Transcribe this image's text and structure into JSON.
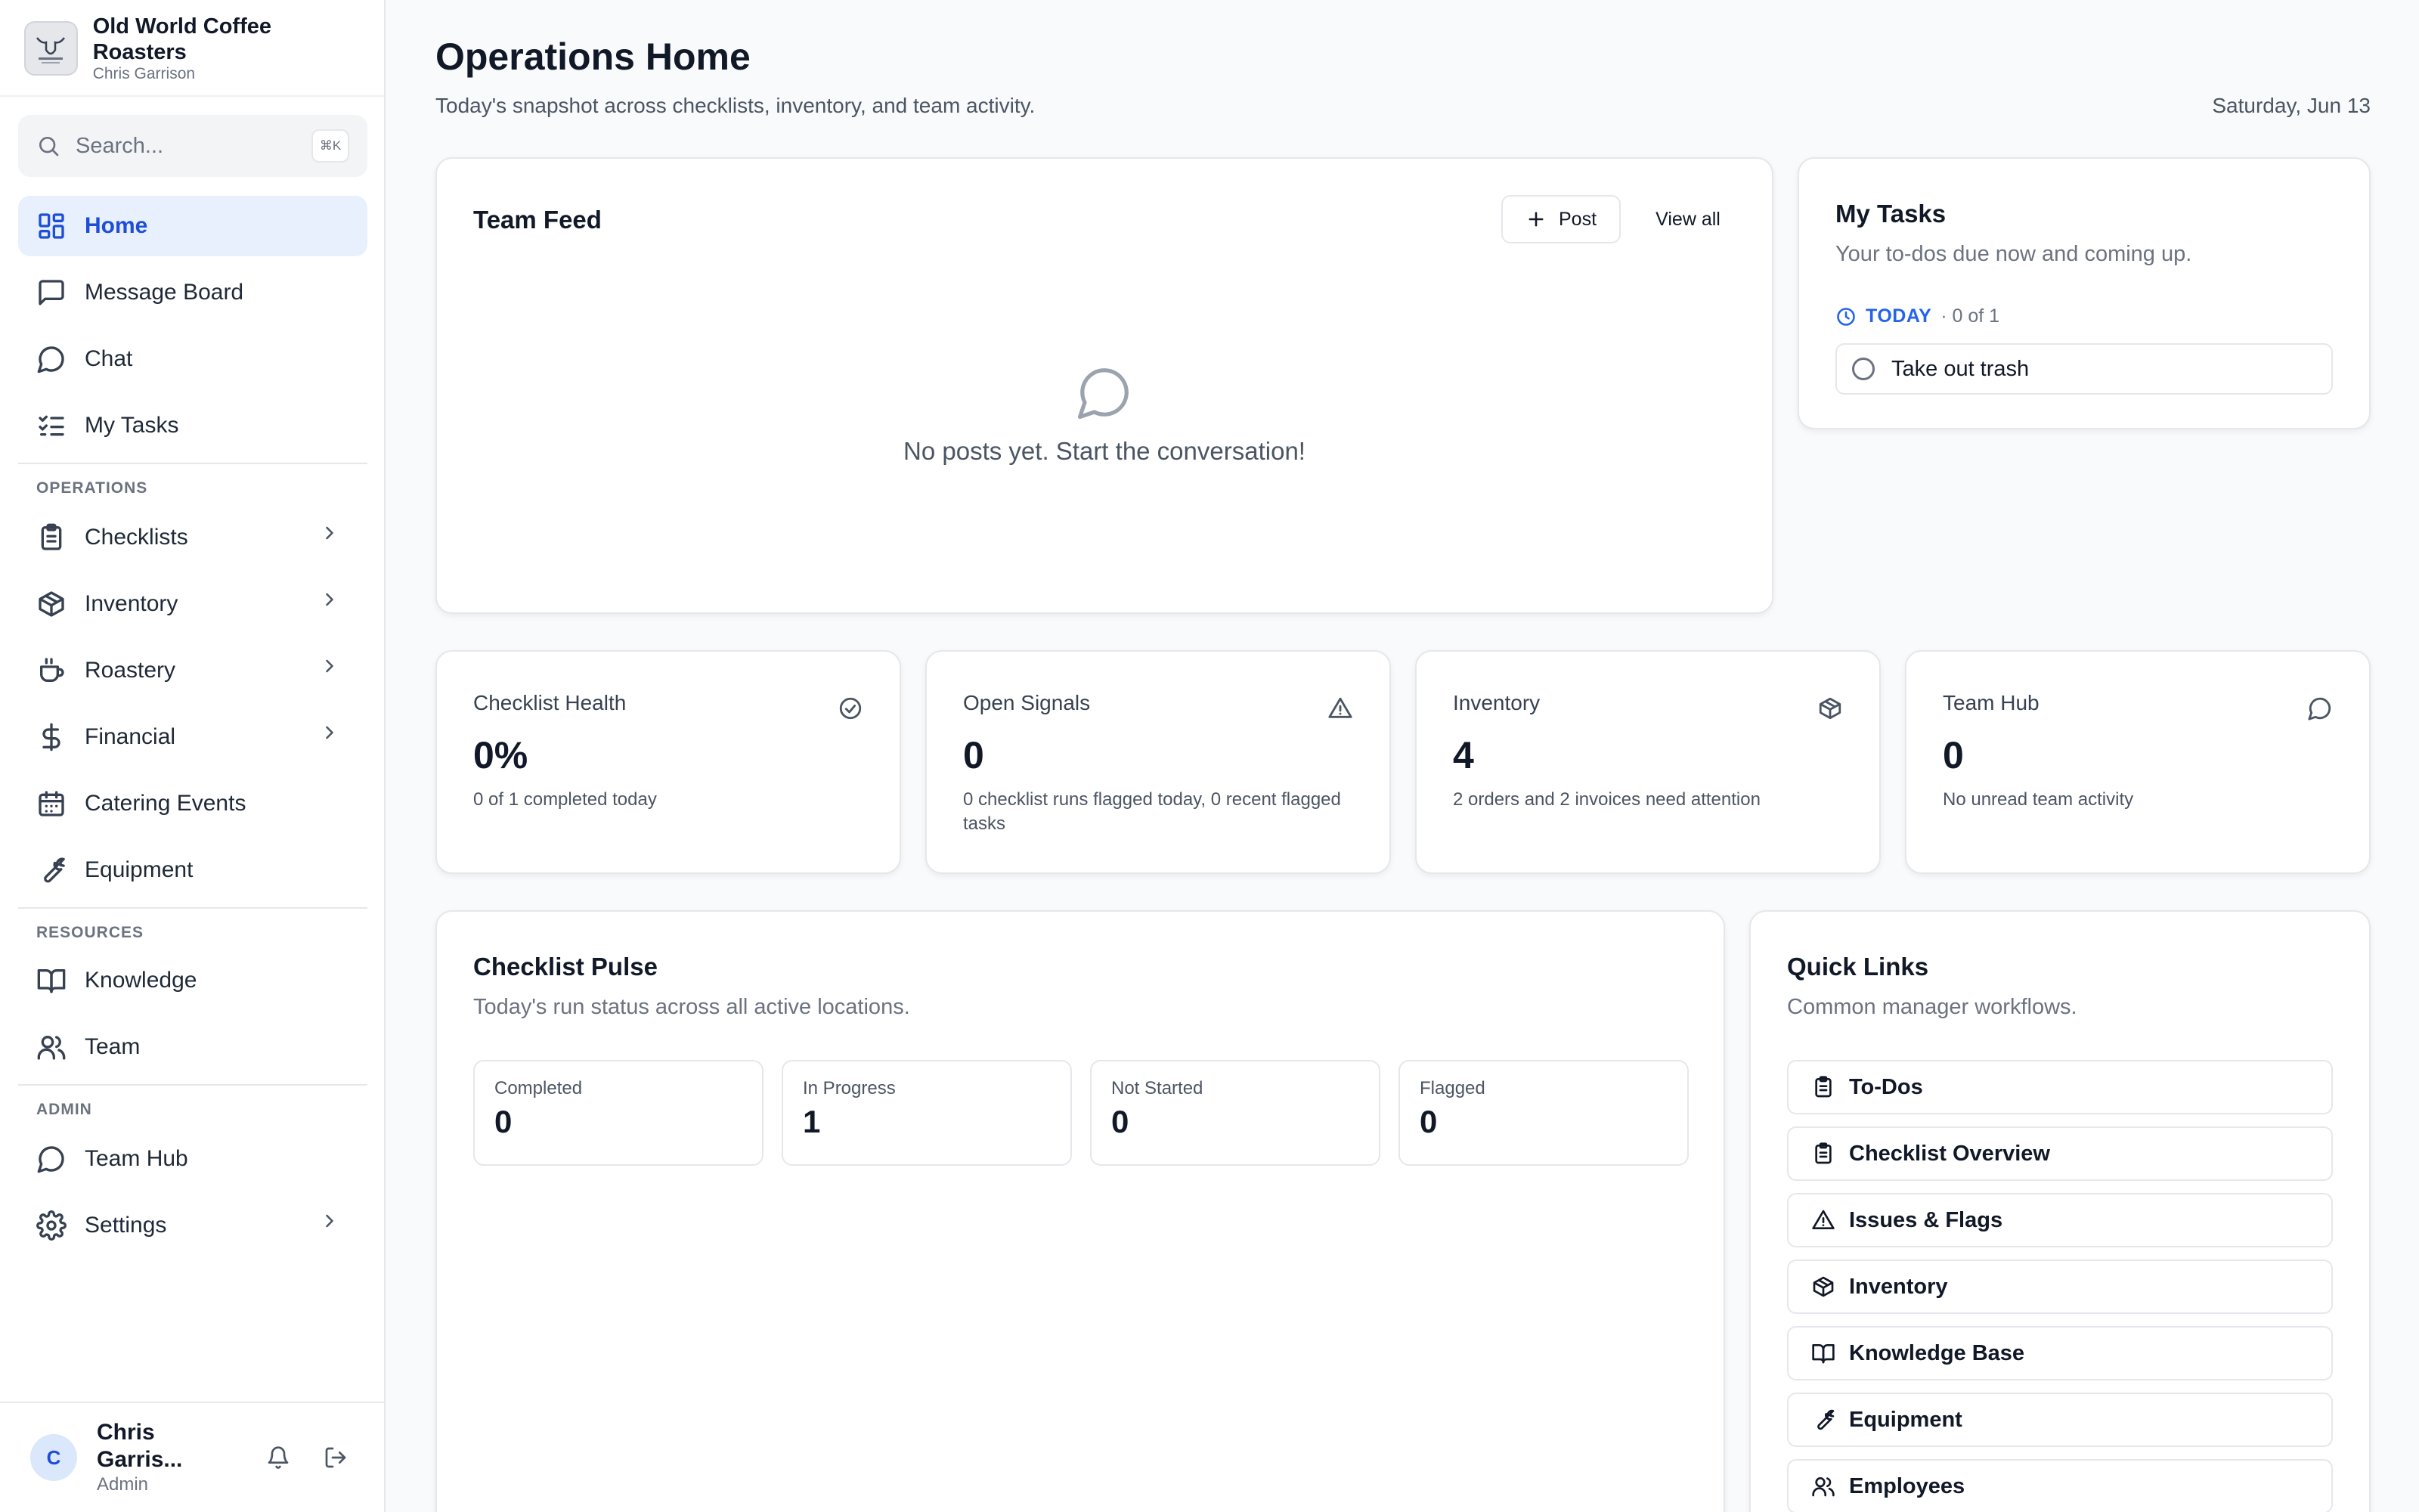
{
  "brand": {
    "name": "Old World Coffee Roasters",
    "user": "Chris Garrison"
  },
  "search": {
    "placeholder": "Search...",
    "shortcut": "⌘K"
  },
  "nav": {
    "home": "Home",
    "message_board": "Message Board",
    "chat": "Chat",
    "my_tasks": "My Tasks",
    "operations_label": "OPERATIONS",
    "checklists": "Checklists",
    "inventory": "Inventory",
    "roastery": "Roastery",
    "financial": "Financial",
    "catering_events": "Catering Events",
    "equipment": "Equipment",
    "resources_label": "RESOURCES",
    "knowledge": "Knowledge",
    "team": "Team",
    "admin_label": "ADMIN",
    "team_hub": "Team Hub",
    "settings": "Settings"
  },
  "user": {
    "initial": "C",
    "name": "Chris Garris...",
    "role": "Admin"
  },
  "header": {
    "title": "Operations Home",
    "subtitle": "Today's snapshot across checklists, inventory, and team activity.",
    "date": "Saturday, Jun 13"
  },
  "team_feed": {
    "title": "Team Feed",
    "post_label": "Post",
    "view_all_label": "View all",
    "empty_text": "No posts yet. Start the conversation!"
  },
  "my_tasks": {
    "title": "My Tasks",
    "subtitle": "Your to-dos due now and coming up.",
    "today_label": "TODAY",
    "today_count": "· 0 of 1",
    "tasks": [
      {
        "label": "Take out trash",
        "done": false
      }
    ]
  },
  "stats": [
    {
      "title": "Checklist Health",
      "value": "0%",
      "desc": "0 of 1 completed today",
      "icon": "check-circle-icon"
    },
    {
      "title": "Open Signals",
      "value": "0",
      "desc": "0 checklist runs flagged today, 0 recent flagged tasks",
      "icon": "alert-triangle-icon"
    },
    {
      "title": "Inventory",
      "value": "4",
      "desc": "2 orders and 2 invoices need attention",
      "icon": "package-icon"
    },
    {
      "title": "Team Hub",
      "value": "0",
      "desc": "No unread team activity",
      "icon": "message-circle-icon"
    }
  ],
  "checklist_pulse": {
    "title": "Checklist Pulse",
    "subtitle": "Today's run status across all active locations.",
    "boxes": [
      {
        "label": "Completed",
        "value": "0"
      },
      {
        "label": "In Progress",
        "value": "1"
      },
      {
        "label": "Not Started",
        "value": "0"
      },
      {
        "label": "Flagged",
        "value": "0"
      }
    ]
  },
  "quick_links": {
    "title": "Quick Links",
    "subtitle": "Common manager workflows.",
    "items": [
      {
        "label": "To-Dos",
        "icon": "clipboard-icon"
      },
      {
        "label": "Checklist Overview",
        "icon": "clipboard-icon"
      },
      {
        "label": "Issues & Flags",
        "icon": "alert-triangle-icon"
      },
      {
        "label": "Inventory",
        "icon": "package-icon"
      },
      {
        "label": "Knowledge Base",
        "icon": "book-icon"
      },
      {
        "label": "Equipment",
        "icon": "wrench-icon"
      },
      {
        "label": "Employees",
        "icon": "users-icon"
      }
    ]
  },
  "colors": {
    "accent": "#2563eb",
    "active_bg": "#e8effd",
    "border": "#e5e7eb",
    "text_muted": "#6b7280"
  }
}
